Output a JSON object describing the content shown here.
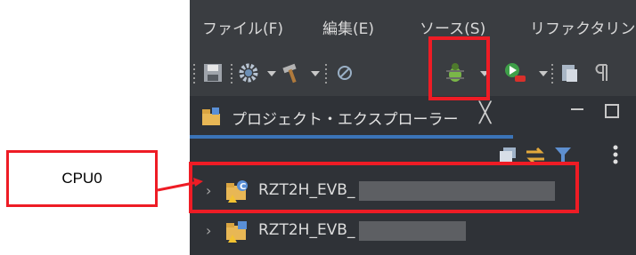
{
  "menu": {
    "items": [
      "ファイル(F)",
      "編集(E)",
      "ソース(S)",
      "リファクタリン"
    ]
  },
  "toolbar": {
    "icons": [
      "save-icon",
      "gear-build-icon",
      "hammer-icon",
      "search-target-icon",
      "debug-bug-icon",
      "run-icon",
      "paste-icon"
    ]
  },
  "explorer": {
    "tab_title": "プロジェクト・エクスプローラー",
    "tab_close": "╳",
    "rows": [
      {
        "label": "RZT2H_EVB_",
        "arrow": "›"
      },
      {
        "label": "RZT2H_EVB_",
        "arrow": "›"
      }
    ]
  },
  "callout": {
    "text": "CPU0"
  },
  "colors": {
    "highlight": "#ee1c25",
    "ide_background": "#2f3237",
    "tab_underline": "#3b74b8"
  }
}
